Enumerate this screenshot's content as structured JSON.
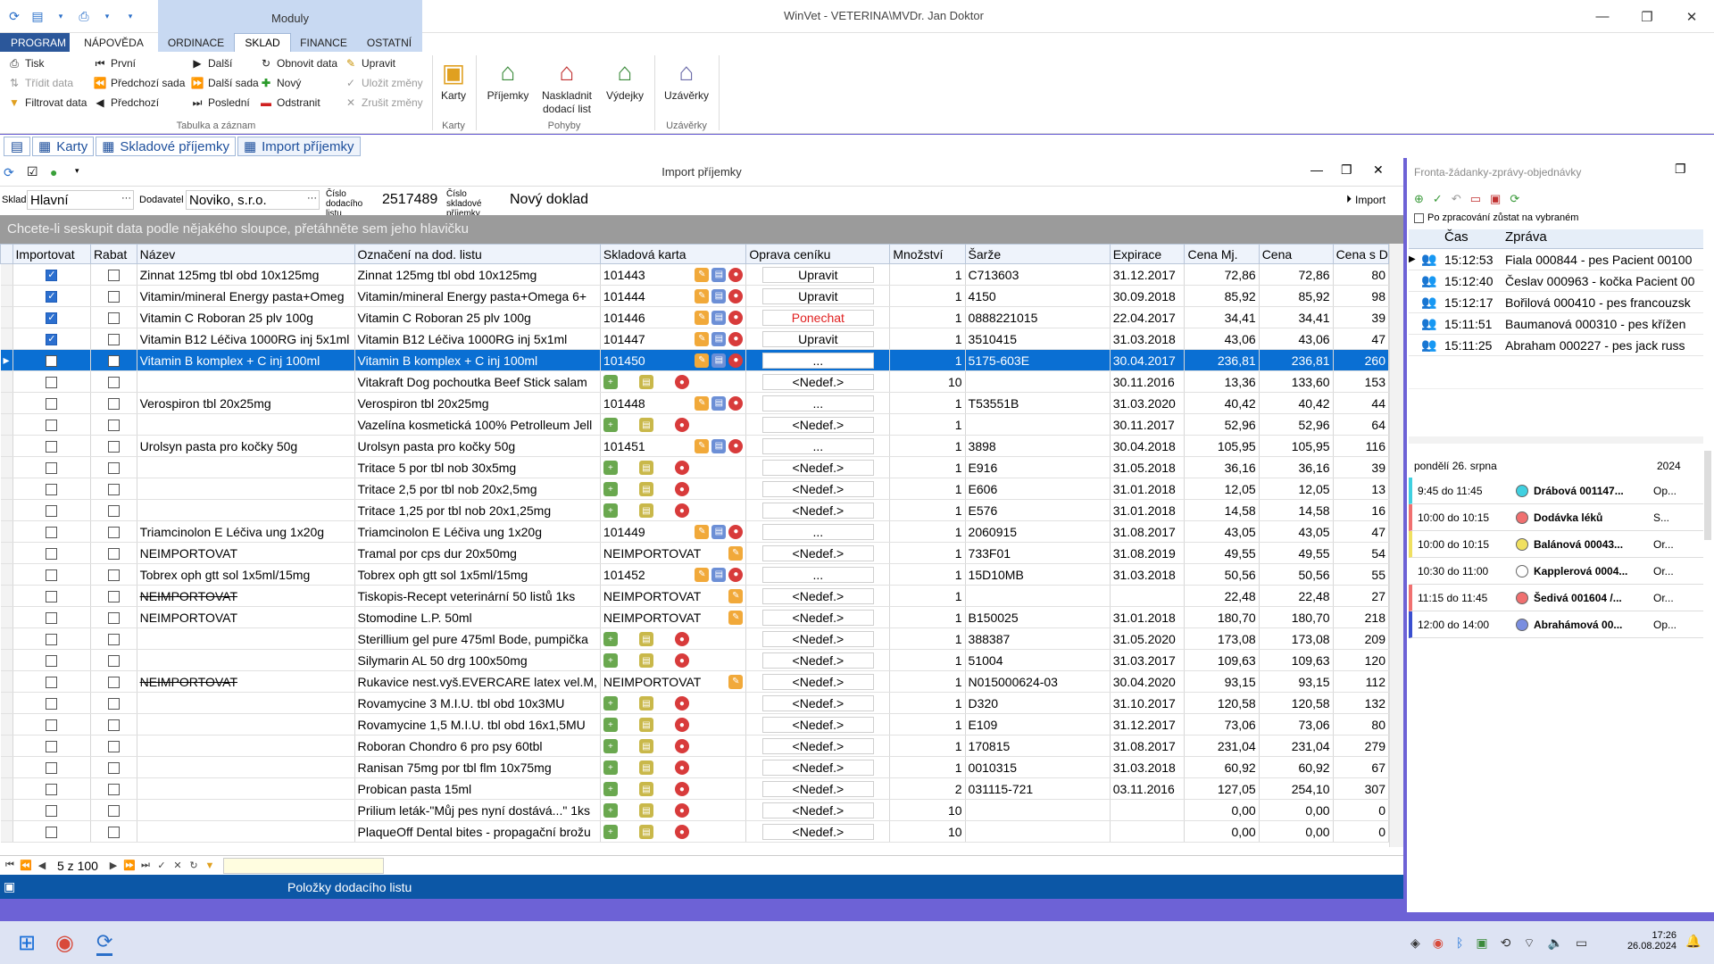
{
  "app": {
    "title": "WinVet - VETERINA\\MVDr. Jan Doktor",
    "modules_label": "Moduly"
  },
  "tabs": [
    "PROGRAM",
    "NÁPOVĚDA",
    "ORDINACE",
    "SKLAD",
    "FINANCE",
    "OSTATNÍ"
  ],
  "ribbon": {
    "col1": [
      "Tisk",
      "Třídit data",
      "Filtrovat data"
    ],
    "col2": [
      "První",
      "Předchozí sada",
      "Předchozí"
    ],
    "col3": [
      "Další",
      "Další sada",
      "Poslední"
    ],
    "col4": [
      "Obnovit data",
      "Nový",
      "Odstranit"
    ],
    "col5": [
      "Upravit",
      "Uložit změny",
      "Zrušit změny"
    ],
    "group1_label": "Tabulka a záznam",
    "karty": "Karty",
    "karty_group": "Karty",
    "prijemky": "Příjemky",
    "naskladnit": "Naskladnit dodací list",
    "vydejky": "Výdejky",
    "pohyby_group": "Pohyby",
    "uzaverky": "Uzávěrky",
    "uzaverky_group": "Uzávěrky"
  },
  "doc_tabs": [
    "Karty",
    "Skladové příjemky",
    "Import příjemky"
  ],
  "inner": {
    "title": "Import příjemky",
    "sklad_label": "Sklad",
    "sklad_value": "Hlavní",
    "dodavatel_label": "Dodavatel",
    "dodavatel_value": "Noviko, s.r.o.",
    "cislo_dl_label": "Číslo dodacího listu",
    "cislo_dl_value": "2517489",
    "cislo_prijemky_label": "Číslo skladové příjemky",
    "cislo_prijemky_value": "Nový doklad",
    "import_button": "Import",
    "group_hint": "Chcete-li seskupit data podle nějakého sloupce, přetáhněte sem jeho hlavičku"
  },
  "columns": [
    "Importovat",
    "Rabat",
    "Název",
    "Označení na dod. listu",
    "Skladová karta",
    "Oprava ceníku",
    "Množství",
    "Šarže",
    "Expirace",
    "Cena Mj.",
    "Cena",
    "Cena s D"
  ],
  "rows": [
    {
      "imp": true,
      "nazev": "Zinnat 125mg tbl obd 10x125mg",
      "ozn": "Zinnat 125mg tbl obd 10x125mg",
      "karta": "101443",
      "k": "edit",
      "opr": "Upravit",
      "mn": "1",
      "sarze": "C713603",
      "exp": "31.12.2017",
      "cmj": "72,86",
      "cena": "72,86",
      "csd": "80"
    },
    {
      "imp": true,
      "nazev": "Vitamin/mineral Energy pasta+Omeg",
      "ozn": "Vitamin/mineral Energy pasta+Omega 6+",
      "karta": "101444",
      "k": "edit",
      "opr": "Upravit",
      "mn": "1",
      "sarze": "4150",
      "exp": "30.09.2018",
      "cmj": "85,92",
      "cena": "85,92",
      "csd": "98"
    },
    {
      "imp": true,
      "nazev": "Vitamin C Roboran 25 plv 100g",
      "ozn": "Vitamin C Roboran 25 plv 100g",
      "karta": "101446",
      "k": "edit",
      "opr": "Ponechat",
      "red": true,
      "mn": "1",
      "sarze": "0888221015",
      "exp": "22.04.2017",
      "cmj": "34,41",
      "cena": "34,41",
      "csd": "39"
    },
    {
      "imp": true,
      "nazev": "Vitamin B12 Léčiva 1000RG inj 5x1ml",
      "ozn": "Vitamin B12 Léčiva 1000RG inj 5x1ml",
      "karta": "101447",
      "k": "edit",
      "opr": "Upravit",
      "mn": "1",
      "sarze": "3510415",
      "exp": "31.03.2018",
      "cmj": "43,06",
      "cena": "43,06",
      "csd": "47"
    },
    {
      "imp": false,
      "sel": true,
      "nazev": "Vitamin B komplex + C inj 100ml",
      "ozn": "Vitamin B komplex + C inj 100ml",
      "karta": "101450",
      "k": "edit",
      "opr": "...",
      "mn": "1",
      "sarze": "5175-603E",
      "exp": "30.04.2017",
      "cmj": "236,81",
      "cena": "236,81",
      "csd": "260"
    },
    {
      "imp": false,
      "nazev": "",
      "ozn": "Vitakraft Dog pochoutka Beef Stick salam",
      "karta": "",
      "k": "new",
      "opr": "<Nedef.>",
      "mn": "10",
      "sarze": "",
      "exp": "30.11.2016",
      "cmj": "13,36",
      "cena": "133,60",
      "csd": "153"
    },
    {
      "imp": false,
      "nazev": "Verospiron tbl 20x25mg",
      "ozn": "Verospiron tbl 20x25mg",
      "karta": "101448",
      "k": "edit",
      "opr": "...",
      "mn": "1",
      "sarze": "T53551B",
      "exp": "31.03.2020",
      "cmj": "40,42",
      "cena": "40,42",
      "csd": "44"
    },
    {
      "imp": false,
      "nazev": "",
      "ozn": "Vazelína kosmetická 100% Petrolleum Jell",
      "karta": "",
      "k": "new",
      "opr": "<Nedef.>",
      "mn": "1",
      "sarze": "",
      "exp": "30.11.2017",
      "cmj": "52,96",
      "cena": "52,96",
      "csd": "64"
    },
    {
      "imp": false,
      "nazev": "Urolsyn pasta pro kočky 50g",
      "ozn": "Urolsyn pasta pro kočky 50g",
      "karta": "101451",
      "k": "edit",
      "opr": "...",
      "mn": "1",
      "sarze": "3898",
      "exp": "30.04.2018",
      "cmj": "105,95",
      "cena": "105,95",
      "csd": "116"
    },
    {
      "imp": false,
      "nazev": "",
      "ozn": "Tritace 5 por tbl nob 30x5mg",
      "karta": "",
      "k": "new",
      "opr": "<Nedef.>",
      "mn": "1",
      "sarze": "E916",
      "exp": "31.05.2018",
      "cmj": "36,16",
      "cena": "36,16",
      "csd": "39"
    },
    {
      "imp": false,
      "nazev": "",
      "ozn": "Tritace 2,5 por tbl nob 20x2,5mg",
      "karta": "",
      "k": "new",
      "opr": "<Nedef.>",
      "mn": "1",
      "sarze": "E606",
      "exp": "31.01.2018",
      "cmj": "12,05",
      "cena": "12,05",
      "csd": "13"
    },
    {
      "imp": false,
      "nazev": "",
      "ozn": "Tritace 1,25 por tbl nob 20x1,25mg",
      "karta": "",
      "k": "new",
      "opr": "<Nedef.>",
      "mn": "1",
      "sarze": "E576",
      "exp": "31.01.2018",
      "cmj": "14,58",
      "cena": "14,58",
      "csd": "16"
    },
    {
      "imp": false,
      "nazev": "Triamcinolon E Léčiva ung 1x20g",
      "ozn": "Triamcinolon E Léčiva ung 1x20g",
      "karta": "101449",
      "k": "edit",
      "opr": "...",
      "mn": "1",
      "sarze": "2060915",
      "exp": "31.08.2017",
      "cmj": "43,05",
      "cena": "43,05",
      "csd": "47"
    },
    {
      "imp": false,
      "nazev": "NEIMPORTOVAT",
      "ozn": "Tramal por cps dur 20x50mg",
      "karta": "NEIMPORTOVAT",
      "k": "one",
      "opr": "<Nedef.>",
      "mn": "1",
      "sarze": "733F01",
      "exp": "31.08.2019",
      "cmj": "49,55",
      "cena": "49,55",
      "csd": "54"
    },
    {
      "imp": false,
      "nazev": "Tobrex oph gtt sol 1x5ml/15mg",
      "ozn": "Tobrex oph gtt sol 1x5ml/15mg",
      "karta": "101452",
      "k": "edit",
      "opr": "...",
      "mn": "1",
      "sarze": "15D10MB",
      "exp": "31.03.2018",
      "cmj": "50,56",
      "cena": "50,56",
      "csd": "55"
    },
    {
      "imp": false,
      "nazev": "NEIMPORTOVAT",
      "strike": true,
      "ozn": "Tiskopis-Recept veterinární 50 listů 1ks",
      "karta": "NEIMPORTOVAT",
      "k": "one",
      "opr": "<Nedef.>",
      "mn": "1",
      "sarze": "",
      "exp": "",
      "cmj": "22,48",
      "cena": "22,48",
      "csd": "27"
    },
    {
      "imp": false,
      "nazev": "NEIMPORTOVAT",
      "ozn": "Stomodine L.P. 50ml",
      "karta": "NEIMPORTOVAT",
      "k": "one",
      "opr": "<Nedef.>",
      "mn": "1",
      "sarze": "B150025",
      "exp": "31.01.2018",
      "cmj": "180,70",
      "cena": "180,70",
      "csd": "218"
    },
    {
      "imp": false,
      "nazev": "",
      "ozn": "Sterillium gel pure 475ml Bode, pumpička",
      "karta": "",
      "k": "new",
      "opr": "<Nedef.>",
      "mn": "1",
      "sarze": "388387",
      "exp": "31.05.2020",
      "cmj": "173,08",
      "cena": "173,08",
      "csd": "209"
    },
    {
      "imp": false,
      "nazev": "",
      "ozn": "Silymarin AL 50 drg 100x50mg",
      "karta": "",
      "k": "new",
      "opr": "<Nedef.>",
      "mn": "1",
      "sarze": "51004",
      "exp": "31.03.2017",
      "cmj": "109,63",
      "cena": "109,63",
      "csd": "120"
    },
    {
      "imp": false,
      "nazev": "NEIMPORTOVAT",
      "strike": true,
      "ozn": "Rukavice nest.vyš.EVERCARE latex vel.M,",
      "karta": "NEIMPORTOVAT",
      "k": "one",
      "opr": "<Nedef.>",
      "mn": "1",
      "sarze": "N015000624-03",
      "exp": "30.04.2020",
      "cmj": "93,15",
      "cena": "93,15",
      "csd": "112"
    },
    {
      "imp": false,
      "nazev": "",
      "ozn": "Rovamycine 3 M.I.U. tbl obd 10x3MU",
      "karta": "",
      "k": "new",
      "opr": "<Nedef.>",
      "mn": "1",
      "sarze": "D320",
      "exp": "31.10.2017",
      "cmj": "120,58",
      "cena": "120,58",
      "csd": "132"
    },
    {
      "imp": false,
      "nazev": "",
      "ozn": "Rovamycine 1,5 M.I.U. tbl obd 16x1,5MU",
      "karta": "",
      "k": "new",
      "opr": "<Nedef.>",
      "mn": "1",
      "sarze": "E109",
      "exp": "31.12.2017",
      "cmj": "73,06",
      "cena": "73,06",
      "csd": "80"
    },
    {
      "imp": false,
      "nazev": "",
      "ozn": "Roboran Chondro 6 pro psy  60tbl",
      "karta": "",
      "k": "new",
      "opr": "<Nedef.>",
      "mn": "1",
      "sarze": "170815",
      "exp": "31.08.2017",
      "cmj": "231,04",
      "cena": "231,04",
      "csd": "279"
    },
    {
      "imp": false,
      "nazev": "",
      "ozn": "Ranisan 75mg por tbl flm 10x75mg",
      "karta": "",
      "k": "new",
      "opr": "<Nedef.>",
      "mn": "1",
      "sarze": "0010315",
      "exp": "31.03.2018",
      "cmj": "60,92",
      "cena": "60,92",
      "csd": "67"
    },
    {
      "imp": false,
      "nazev": "",
      "ozn": "Probican pasta 15ml",
      "karta": "",
      "k": "new",
      "opr": "<Nedef.>",
      "mn": "2",
      "sarze": "031115-721",
      "exp": "03.11.2016",
      "cmj": "127,05",
      "cena": "254,10",
      "csd": "307"
    },
    {
      "imp": false,
      "nazev": "",
      "ozn": "Prilium leták-\"Můj pes nyní dostává...\" 1ks",
      "karta": "",
      "k": "new",
      "opr": "<Nedef.>",
      "mn": "10",
      "sarze": "",
      "exp": "",
      "cmj": "0,00",
      "cena": "0,00",
      "csd": "0"
    },
    {
      "imp": false,
      "nazev": "",
      "ozn": "PlaqueOff Dental bites - propagační brožu",
      "karta": "",
      "k": "new",
      "opr": "<Nedef.>",
      "mn": "10",
      "sarze": "",
      "exp": "",
      "cmj": "0,00",
      "cena": "0,00",
      "csd": "0"
    }
  ],
  "nav": {
    "position": "5 z 100"
  },
  "status": "Položky dodacího listu",
  "right": {
    "title": "Fronta-žádanky-zprávy-objednávky",
    "checkbox_label": "Po zpracování zůstat na vybraném",
    "col_cas": "Čas",
    "col_zprava": "Zpráva",
    "queue": [
      {
        "cas": "15:12:53",
        "msg": "Fiala 000844 - pes Pacient 00100"
      },
      {
        "cas": "15:12:40",
        "msg": "Česlav 000963 - kočka Pacient 00"
      },
      {
        "cas": "15:12:17",
        "msg": "Bořilová 000410 - pes francouzsk"
      },
      {
        "cas": "15:11:51",
        "msg": "Baumanová 000310 - pes křížen"
      },
      {
        "cas": "15:11:25",
        "msg": "Abraham 000227 - pes jack russ"
      }
    ],
    "cal_date": "pondělí 26. srpna",
    "cal_year": "2024",
    "calendar": [
      {
        "time": "9:45 do 11:45",
        "name": "Drábová 001147...",
        "extra": "Op...",
        "color": "#40d0e0",
        "bar": "#40d0e0"
      },
      {
        "time": "10:00 do 10:15",
        "name": "Dodávka léků",
        "extra": "S...",
        "color": "#f07070",
        "bar": "#f07070"
      },
      {
        "time": "10:00 do 10:15",
        "name": "Balánová 00043...",
        "extra": "Or...",
        "color": "#f0e060",
        "bar": "#f0e060"
      },
      {
        "time": "10:30 do 11:00",
        "name": "Kapplerová 0004...",
        "extra": "Or...",
        "color": "#ffffff",
        "bar": "#ffffff"
      },
      {
        "time": "11:15 do 11:45",
        "name": "Šedivá 001604 /...",
        "extra": "Or...",
        "color": "#f07070",
        "bar": "#f07070"
      },
      {
        "time": "12:00 do 14:00",
        "name": "Abrahámová 00...",
        "extra": "Op...",
        "color": "#7a8ee0",
        "bar": "#3a4fd0"
      }
    ]
  },
  "taskbar": {
    "time": "17:26",
    "date": "26.08.2024"
  }
}
